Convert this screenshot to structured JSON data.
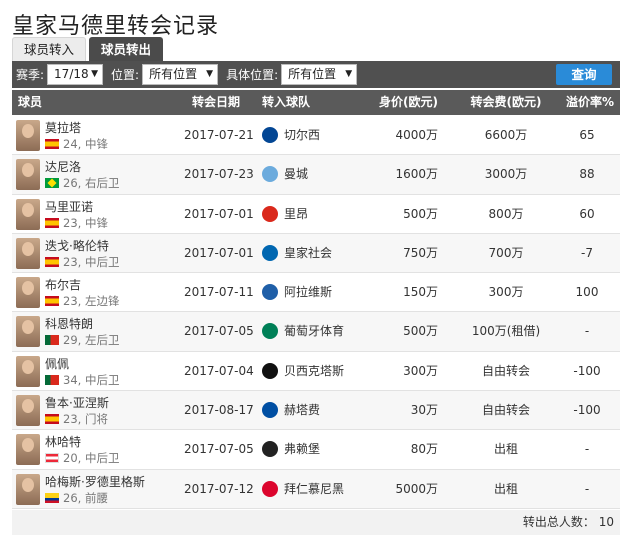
{
  "page": {
    "title": "皇家马德里转会记录"
  },
  "tabs": [
    {
      "label": "球员转入",
      "active": false
    },
    {
      "label": "球员转出",
      "active": true
    }
  ],
  "filters": {
    "season_label": "赛季:",
    "season_value": "17/18",
    "position_label": "位置:",
    "position_value": "所有位置",
    "detail_position_label": "具体位置:",
    "detail_position_value": "所有位置",
    "query_label": "查询"
  },
  "table": {
    "headers": {
      "player": "球员",
      "date": "转会日期",
      "club": "转入球队",
      "value": "身价(欧元)",
      "fee": "转会费(欧元)",
      "rate": "溢价率%"
    },
    "rows": [
      {
        "name": "莫拉塔",
        "sub": "24, 中锋",
        "flag": "es",
        "date": "2017-07-21",
        "club": "切尔西",
        "badge_color": "#034694",
        "value": "4000万",
        "fee": "6600万",
        "rate": "65"
      },
      {
        "name": "达尼洛",
        "sub": "26, 右后卫",
        "flag": "br",
        "date": "2017-07-23",
        "club": "曼城",
        "badge_color": "#6cabdd",
        "value": "1600万",
        "fee": "3000万",
        "rate": "88"
      },
      {
        "name": "马里亚诺",
        "sub": "23, 中锋",
        "flag": "es",
        "date": "2017-07-01",
        "club": "里昂",
        "badge_color": "#da291c",
        "value": "500万",
        "fee": "800万",
        "rate": "60"
      },
      {
        "name": "迭戈·略伦特",
        "sub": "23, 中后卫",
        "flag": "es",
        "date": "2017-07-01",
        "club": "皇家社会",
        "badge_color": "#0067b1",
        "value": "750万",
        "fee": "700万",
        "rate": "-7"
      },
      {
        "name": "布尔吉",
        "sub": "23, 左边锋",
        "flag": "es",
        "date": "2017-07-11",
        "club": "阿拉维斯",
        "badge_color": "#1f5fa8",
        "value": "150万",
        "fee": "300万",
        "rate": "100"
      },
      {
        "name": "科恩特朗",
        "sub": "29, 左后卫",
        "flag": "pt",
        "date": "2017-07-05",
        "club": "葡萄牙体育",
        "badge_color": "#008057",
        "value": "500万",
        "fee": "100万(租借)",
        "rate": "-"
      },
      {
        "name": "佩佩",
        "sub": "34, 中后卫",
        "flag": "pt",
        "date": "2017-07-04",
        "club": "贝西克塔斯",
        "badge_color": "#111111",
        "value": "300万",
        "fee": "自由转会",
        "rate": "-100"
      },
      {
        "name": "鲁本·亚涅斯",
        "sub": "23, 门将",
        "flag": "es",
        "date": "2017-08-17",
        "club": "赫塔费",
        "badge_color": "#004fa3",
        "value": "30万",
        "fee": "自由转会",
        "rate": "-100"
      },
      {
        "name": "林哈特",
        "sub": "20, 中后卫",
        "flag": "at",
        "date": "2017-07-05",
        "club": "弗赖堡",
        "badge_color": "#222222",
        "value": "80万",
        "fee": "出租",
        "rate": "-"
      },
      {
        "name": "哈梅斯·罗德里格斯",
        "sub": "26, 前腰",
        "flag": "co",
        "date": "2017-07-12",
        "club": "拜仁慕尼黑",
        "badge_color": "#dc052d",
        "value": "5000万",
        "fee": "出租",
        "rate": "-"
      }
    ]
  },
  "footer": {
    "total_text": "转出总人数： 10"
  }
}
